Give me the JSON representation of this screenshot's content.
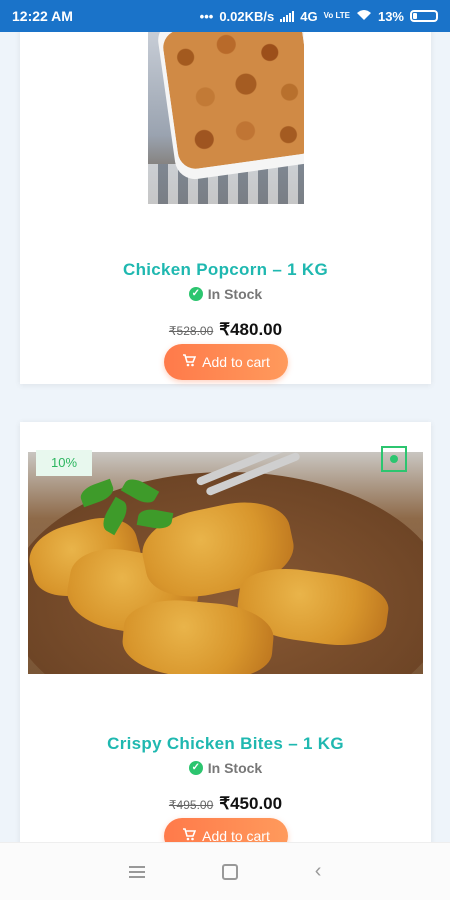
{
  "status_bar": {
    "time": "12:22 AM",
    "network_speed": "0.02KB/s",
    "network_type": "4G",
    "volte": "Vo LTE",
    "battery": "13%",
    "icons": [
      "dots-icon",
      "signal-icon",
      "wifi-icon",
      "battery-icon"
    ]
  },
  "products": [
    {
      "name": "Chicken Popcorn – 1 KG",
      "stock": "In Stock",
      "old_price": "₹528.00",
      "new_price": "₹480.00",
      "cart_label": "Add to cart"
    },
    {
      "name": "Crispy Chicken Bites – 1 KG",
      "stock": "In Stock",
      "old_price": "₹495.00",
      "new_price": "₹450.00",
      "cart_label": "Add to cart",
      "discount_badge": "10%"
    }
  ],
  "nav_bar": {
    "icons": [
      "menu-icon",
      "home-icon",
      "back-icon"
    ]
  },
  "colors": {
    "status_bar": "#1a73c9",
    "title": "#1fb8b0",
    "in_stock": "#2cc56f",
    "cart_button": "#ff8552"
  }
}
